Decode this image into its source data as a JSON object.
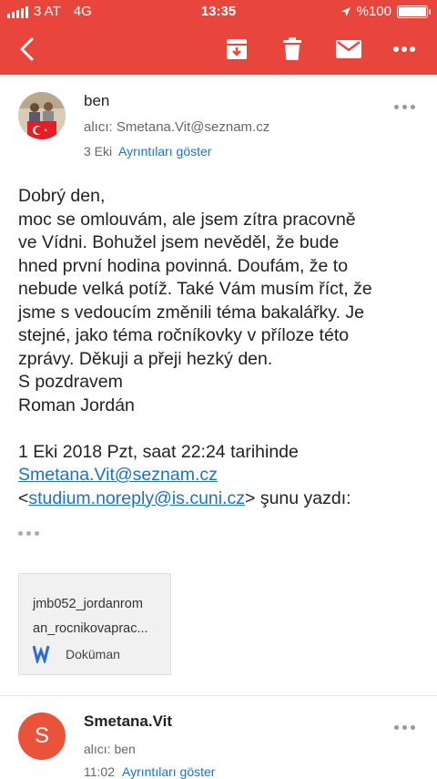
{
  "status_bar": {
    "carrier": "3 AT",
    "network": "4G",
    "time": "13:35",
    "battery": "%100"
  },
  "colors": {
    "accent": "#e8453c",
    "link": "#1a73c8",
    "avatar_s": "#e8533a"
  },
  "toolbar": {
    "back_icon": "back-arrow-icon",
    "archive_icon": "archive-icon",
    "delete_icon": "trash-icon",
    "mail_icon": "envelope-icon",
    "more_icon": "more-icon"
  },
  "message1": {
    "sender": "ben",
    "to": "alıcı: Smetana.Vit@seznam.cz",
    "date": "3 Eki",
    "details_link": "Ayrıntıları göster",
    "body_lines": [
      "Dobrý den,",
      "moc se omlouvám, ale jsem zítra pracovně",
      "ve Vídni. Bohužel jsem nevěděl, že bude",
      "hned první hodina povinná. Doufám, že to",
      "nebude velká potíž. Také Vám musím říct, že",
      "jsme s vedoucím změnili téma bakalářky. Je",
      "stejné, jako téma ročníkovky v příloze této",
      "zprávy. Děkuji a přeji hezký den.",
      "S pozdravem",
      "Roman Jordán"
    ],
    "quote_header": "1 Eki 2018 Pzt, saat 22:24 tarihinde",
    "quote_email": "Smetana.Vit@seznam.cz",
    "quote_lt": "<",
    "quote_noreply": "studium.noreply@is.cuni.cz",
    "quote_gt": "> şunu yazdı:",
    "attachment": {
      "name_line1": "jmb052_jordanrom",
      "name_line2": "an_rocnikovaprac...",
      "type": "Doküman"
    }
  },
  "message2": {
    "avatar_letter": "S",
    "sender": "Smetana.Vit",
    "to": "alıcı: ben",
    "time": "11:02",
    "details_link": "Ayrıntıları göster"
  }
}
